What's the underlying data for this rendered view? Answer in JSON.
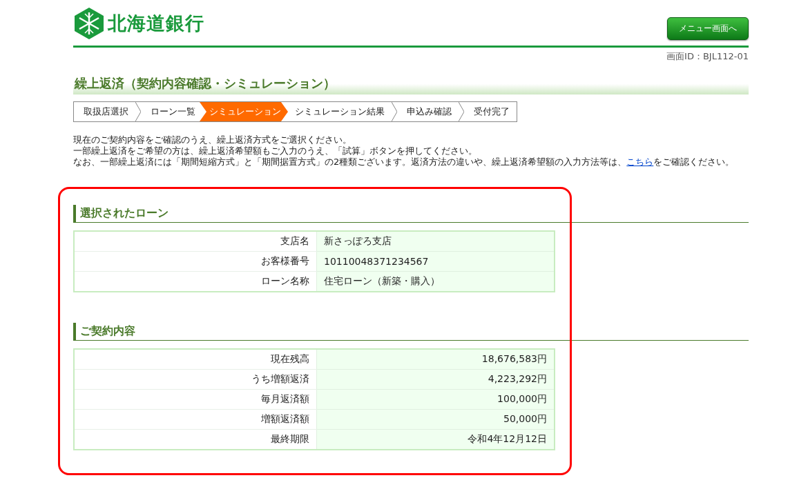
{
  "header": {
    "logo_text": "北海道銀行",
    "menu_button": "メニュー画面へ",
    "screen_id": "画面ID：BJL112-01"
  },
  "page_title": "繰上返済（契約内容確認・シミュレーション）",
  "steps": [
    {
      "label": "取扱店選択",
      "selected": false
    },
    {
      "label": "ローン一覧",
      "selected": false
    },
    {
      "label": "シミュレーション",
      "selected": true
    },
    {
      "label": "シミュレーション結果",
      "selected": false
    },
    {
      "label": "申込み確認",
      "selected": false
    },
    {
      "label": "受付完了",
      "selected": false
    }
  ],
  "intro": [
    "現在のご契約内容をご確認のうえ、繰上返済方式をご選択ください。",
    "一部繰上返済をご希望の方は、繰上返済希望額もご入力のうえ、「試算」ボタンを押してください。"
  ],
  "intro_last": {
    "before": "なお、一部繰上返済には「期間短縮方式」と「期間据置方式」の2種類ございます。返済方法の違いや、繰上返済希望額の入力方法等は、",
    "link": "こちら",
    "after": "をご確認ください。"
  },
  "sections": [
    {
      "title": "選択されたローン",
      "kind": "text",
      "rows": [
        {
          "label": "支店名",
          "value": "新さっぽろ支店"
        },
        {
          "label": "お客様番号",
          "value": "10110048371234567"
        },
        {
          "label": "ローン名称",
          "value": "住宅ローン（新築・購入）"
        }
      ]
    },
    {
      "title": "ご契約内容",
      "kind": "amount",
      "rows": [
        {
          "label": "現在残高",
          "value": "18,676,583円"
        },
        {
          "label": "うち増額返済",
          "value": "4,223,292円"
        },
        {
          "label": "毎月返済額",
          "value": "100,000円"
        },
        {
          "label": "増額返済額",
          "value": "50,000円"
        },
        {
          "label": "最終期限",
          "value": "令和4年12月12日"
        }
      ]
    }
  ],
  "highlight_frame": {
    "color": "#ff0000"
  }
}
